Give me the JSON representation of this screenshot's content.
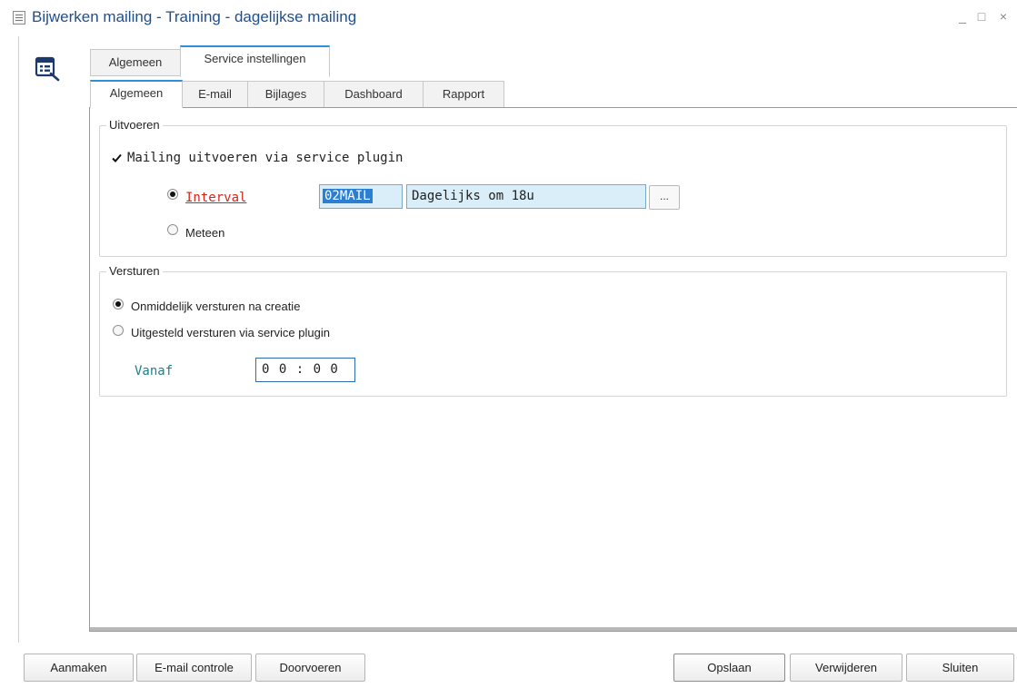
{
  "window": {
    "title": "Bijwerken mailing - Training - dagelijkse mailing",
    "minimize": "_",
    "maximize": "□",
    "close": "×"
  },
  "icons": {
    "title_icon": "document-icon",
    "app_icon": "mailing-list-edit-icon"
  },
  "tabs_top": [
    {
      "label": "Algemeen",
      "active": false
    },
    {
      "label": "Service instellingen",
      "active": true
    }
  ],
  "tabs_sub": [
    {
      "label": "Algemeen",
      "active": true
    },
    {
      "label": "E-mail",
      "active": false
    },
    {
      "label": "Bijlages",
      "active": false
    },
    {
      "label": "Dashboard",
      "active": false
    },
    {
      "label": "Rapport",
      "active": false
    }
  ],
  "uitvoeren": {
    "legend": "Uitvoeren",
    "checkbox_label": "Mailing uitvoeren via service plugin",
    "checkbox_checked": true,
    "radio_interval_label": "Interval",
    "radio_interval_selected": true,
    "radio_meteen_label": "Meteen",
    "radio_meteen_selected": false,
    "interval_code": "02MAIL",
    "interval_description": "Dagelijks om 18u",
    "browse_button": "..."
  },
  "versturen": {
    "legend": "Versturen",
    "radio_direct_label": "Onmiddelijk versturen na creatie",
    "radio_direct_selected": true,
    "radio_delayed_label": "Uitgesteld versturen via service plugin",
    "radio_delayed_selected": false,
    "vanaf_label": "Vanaf",
    "vanaf_value": "0 0 : 0 0"
  },
  "buttons": {
    "aanmaken": "Aanmaken",
    "email_controle": "E-mail controle",
    "doorvoeren": "Doorvoeren",
    "opslaan": "Opslaan",
    "verwijderen": "Verwijderen",
    "sluiten": "Sluiten"
  },
  "colors": {
    "accent": "#2e90d1",
    "title": "#1e4f8f",
    "link_red": "#d9241b",
    "label_teal": "#1f7f8a",
    "field_bg": "#d9eef9"
  }
}
